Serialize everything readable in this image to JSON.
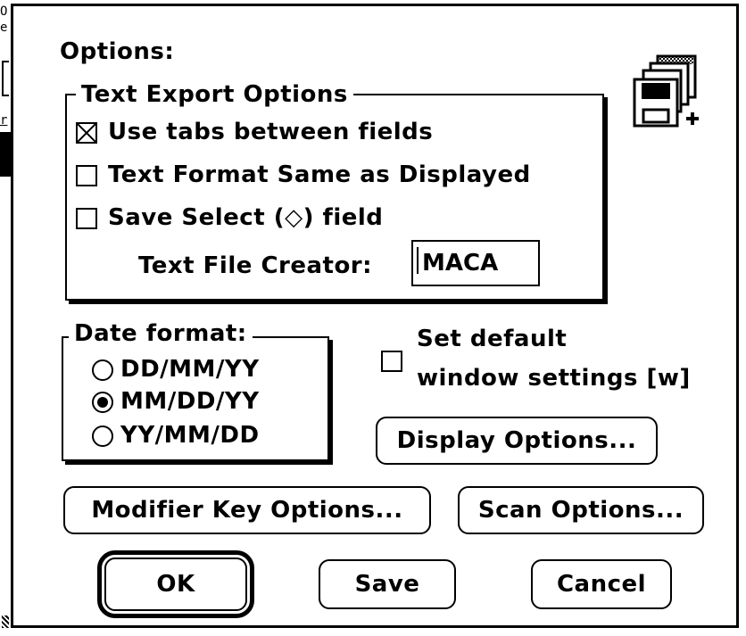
{
  "background": {
    "letters": [
      "O",
      "e",
      "r"
    ]
  },
  "dialog": {
    "title": "Options:",
    "icon": "stacked-floppy-disks-icon",
    "text_export": {
      "legend": "Text Export Options",
      "use_tabs": {
        "label": "Use tabs between fields",
        "checked": true
      },
      "same_format": {
        "label": "Text Format Same as Displayed",
        "checked": false
      },
      "save_select": {
        "label": "Save Select (◇) field",
        "checked": false
      },
      "creator_label": "Text File Creator:",
      "creator_value": "MACA"
    },
    "date_format": {
      "legend": "Date format:",
      "options": [
        {
          "label": "DD/MM/YY",
          "selected": false
        },
        {
          "label": "MM/DD/YY",
          "selected": true
        },
        {
          "label": "YY/MM/DD",
          "selected": false
        }
      ]
    },
    "default_window": {
      "label_line1": "Set default",
      "label_line2": "window settings [w]",
      "checked": false
    },
    "buttons": {
      "display_options": "Display Options...",
      "modifier_key_options": "Modifier Key Options...",
      "scan_options": "Scan Options...",
      "ok": "OK",
      "save": "Save",
      "cancel": "Cancel"
    }
  }
}
